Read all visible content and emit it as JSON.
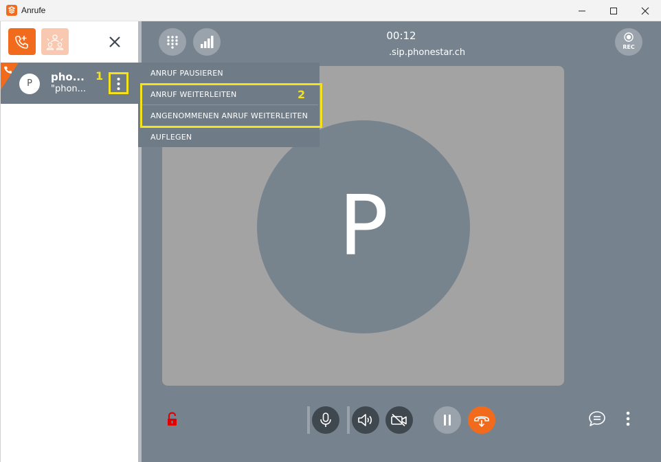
{
  "window": {
    "title": "Anrufe",
    "icons": {
      "app": "app-logo-icon",
      "minimize": "minimize-icon",
      "maximize": "maximize-icon",
      "close": "close-icon"
    }
  },
  "sidebar": {
    "new_call_icon": "phone-plus-icon",
    "conference_icon": "conference-icon",
    "close_icon": "close-icon",
    "call": {
      "avatar_letter": "P",
      "name": "pho...",
      "subtitle": "\"phon...",
      "annotation": "1",
      "more_icon": "more-vertical-icon"
    }
  },
  "call": {
    "timer": "00:12",
    "sip_address": ".sip.phonestar.ch",
    "rec_label": "REC",
    "avatar_letter": "P"
  },
  "menu": {
    "items": [
      {
        "label": "ANRUF PAUSIEREN"
      },
      {
        "label": "ANRUF WEITERLEITEN"
      },
      {
        "label": "ANGENOMMENEN ANRUF WEITERLEITEN"
      },
      {
        "label": "AUFLEGEN"
      }
    ],
    "annotation": "2"
  },
  "controls": {
    "icons": [
      "lock-open-icon",
      "microphone-icon",
      "speaker-icon",
      "video-off-icon",
      "pause-icon",
      "transfer-icon",
      "chat-icon",
      "more-vertical-icon"
    ]
  },
  "colors": {
    "accent": "#f26b1d",
    "main_bg": "#76838e",
    "highlight": "#f4e21c",
    "lock_red": "#e00000"
  }
}
